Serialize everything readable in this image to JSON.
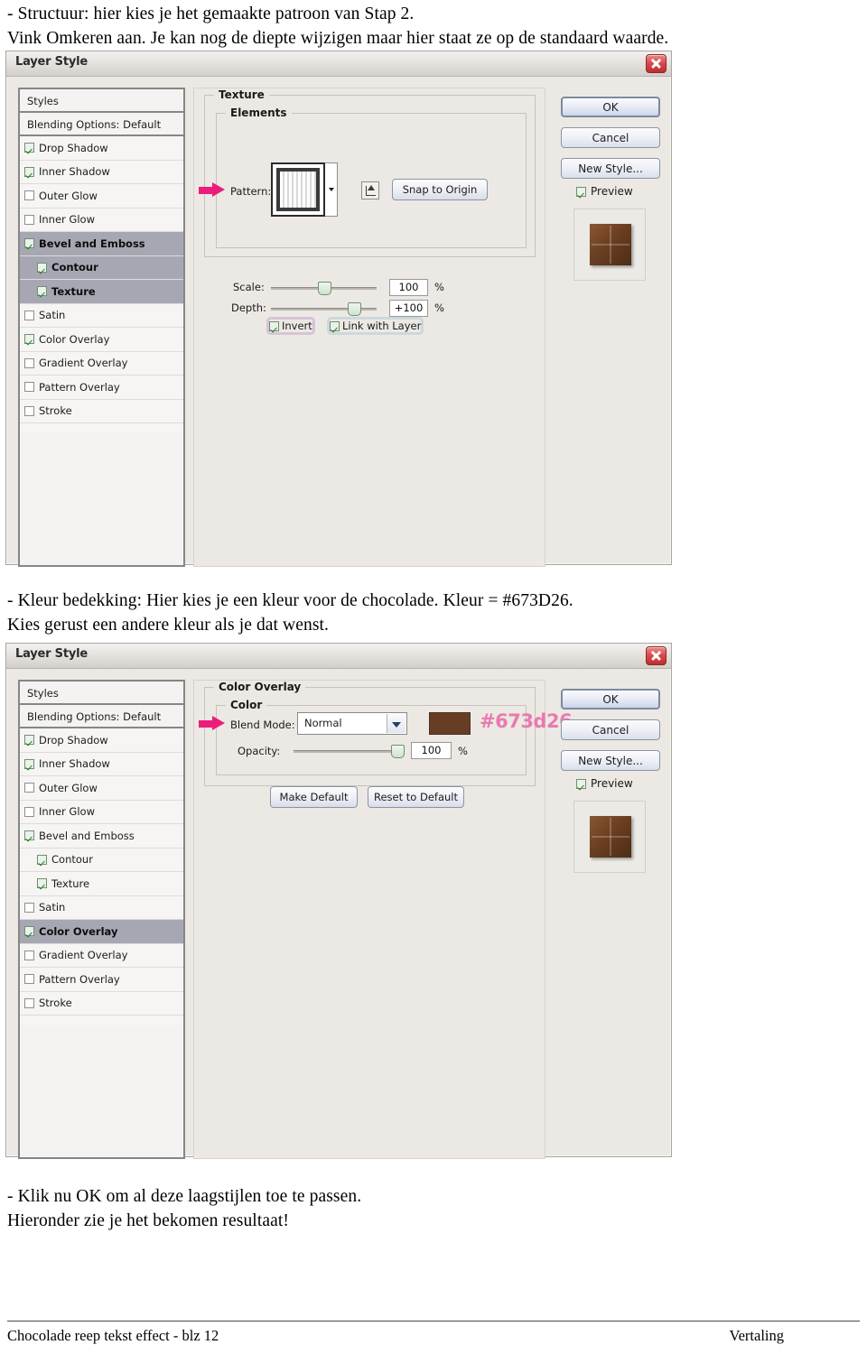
{
  "intro": {
    "line1": "- Structuur: hier kies je het gemaakte patroon van Stap 2.",
    "line2": "Vink Omkeren aan. Je kan nog de diepte wijzigen maar hier staat ze op de standaard waarde."
  },
  "middle": {
    "line1": "- Kleur bedekking: Hier kies je een kleur voor de chocolade. Kleur = #673D26.",
    "line2": "Kies gerust een andere kleur als je dat wenst."
  },
  "ending": {
    "line1": "- Klik nu OK om al deze laagstijlen toe te passen.",
    "line2": "Hieronder zie je het bekomen resultaat!"
  },
  "footer": {
    "left": "Chocolade reep tekst effect - blz 12",
    "right": "Vertaling"
  },
  "dialog1": {
    "title": "Layer Style",
    "styles_header": "Styles",
    "blending_options": "Blending Options: Default",
    "effects": [
      {
        "label": "Drop Shadow",
        "checked": true,
        "indent": false,
        "selected": false
      },
      {
        "label": "Inner Shadow",
        "checked": true,
        "indent": false,
        "selected": false
      },
      {
        "label": "Outer Glow",
        "checked": false,
        "indent": false,
        "selected": false
      },
      {
        "label": "Inner Glow",
        "checked": false,
        "indent": false,
        "selected": false
      },
      {
        "label": "Bevel and Emboss",
        "checked": true,
        "indent": false,
        "selected": true
      },
      {
        "label": "Contour",
        "checked": true,
        "indent": true,
        "selected": true
      },
      {
        "label": "Texture",
        "checked": true,
        "indent": true,
        "selected": true
      },
      {
        "label": "Satin",
        "checked": false,
        "indent": false,
        "selected": false
      },
      {
        "label": "Color Overlay",
        "checked": true,
        "indent": false,
        "selected": false
      },
      {
        "label": "Gradient Overlay",
        "checked": false,
        "indent": false,
        "selected": false
      },
      {
        "label": "Pattern Overlay",
        "checked": false,
        "indent": false,
        "selected": false
      },
      {
        "label": "Stroke",
        "checked": false,
        "indent": false,
        "selected": false
      }
    ],
    "group_texture": "Texture",
    "group_elements": "Elements",
    "pattern_label": "Pattern:",
    "snap_to_origin": "Snap to Origin",
    "scale_label": "Scale:",
    "scale_value": "100",
    "scale_unit": "%",
    "depth_label": "Depth:",
    "depth_value": "+100",
    "depth_unit": "%",
    "invert_label": "Invert",
    "invert_checked": true,
    "link_label": "Link with Layer",
    "link_checked": true,
    "buttons": {
      "ok": "OK",
      "cancel": "Cancel",
      "new_style": "New Style..."
    },
    "preview_label": "Preview",
    "preview_checked": true
  },
  "dialog2": {
    "title": "Layer Style",
    "styles_header": "Styles",
    "blending_options": "Blending Options: Default",
    "effects": [
      {
        "label": "Drop Shadow",
        "checked": true,
        "indent": false,
        "selected": false
      },
      {
        "label": "Inner Shadow",
        "checked": true,
        "indent": false,
        "selected": false
      },
      {
        "label": "Outer Glow",
        "checked": false,
        "indent": false,
        "selected": false
      },
      {
        "label": "Inner Glow",
        "checked": false,
        "indent": false,
        "selected": false
      },
      {
        "label": "Bevel and Emboss",
        "checked": true,
        "indent": false,
        "selected": false
      },
      {
        "label": "Contour",
        "checked": true,
        "indent": true,
        "selected": false
      },
      {
        "label": "Texture",
        "checked": true,
        "indent": true,
        "selected": false
      },
      {
        "label": "Satin",
        "checked": false,
        "indent": false,
        "selected": false
      },
      {
        "label": "Color Overlay",
        "checked": true,
        "indent": false,
        "selected": true
      },
      {
        "label": "Gradient Overlay",
        "checked": false,
        "indent": false,
        "selected": false
      },
      {
        "label": "Pattern Overlay",
        "checked": false,
        "indent": false,
        "selected": false
      },
      {
        "label": "Stroke",
        "checked": false,
        "indent": false,
        "selected": false
      }
    ],
    "group_color_overlay": "Color Overlay",
    "group_color": "Color",
    "blend_mode_label": "Blend Mode:",
    "blend_mode_value": "Normal",
    "color_hex": "#673d26",
    "color_swatch": "#673d26",
    "opacity_label": "Opacity:",
    "opacity_value": "100",
    "opacity_unit": "%",
    "make_default": "Make Default",
    "reset_to_default": "Reset to Default",
    "buttons": {
      "ok": "OK",
      "cancel": "Cancel",
      "new_style": "New Style..."
    },
    "preview_label": "Preview",
    "preview_checked": true
  },
  "colors": {
    "accent_pink": "#ec1d7a",
    "hex_text_pink": "#e97ab0",
    "chocolate": "#673d26",
    "selection_gray": "#a7a7b4"
  }
}
